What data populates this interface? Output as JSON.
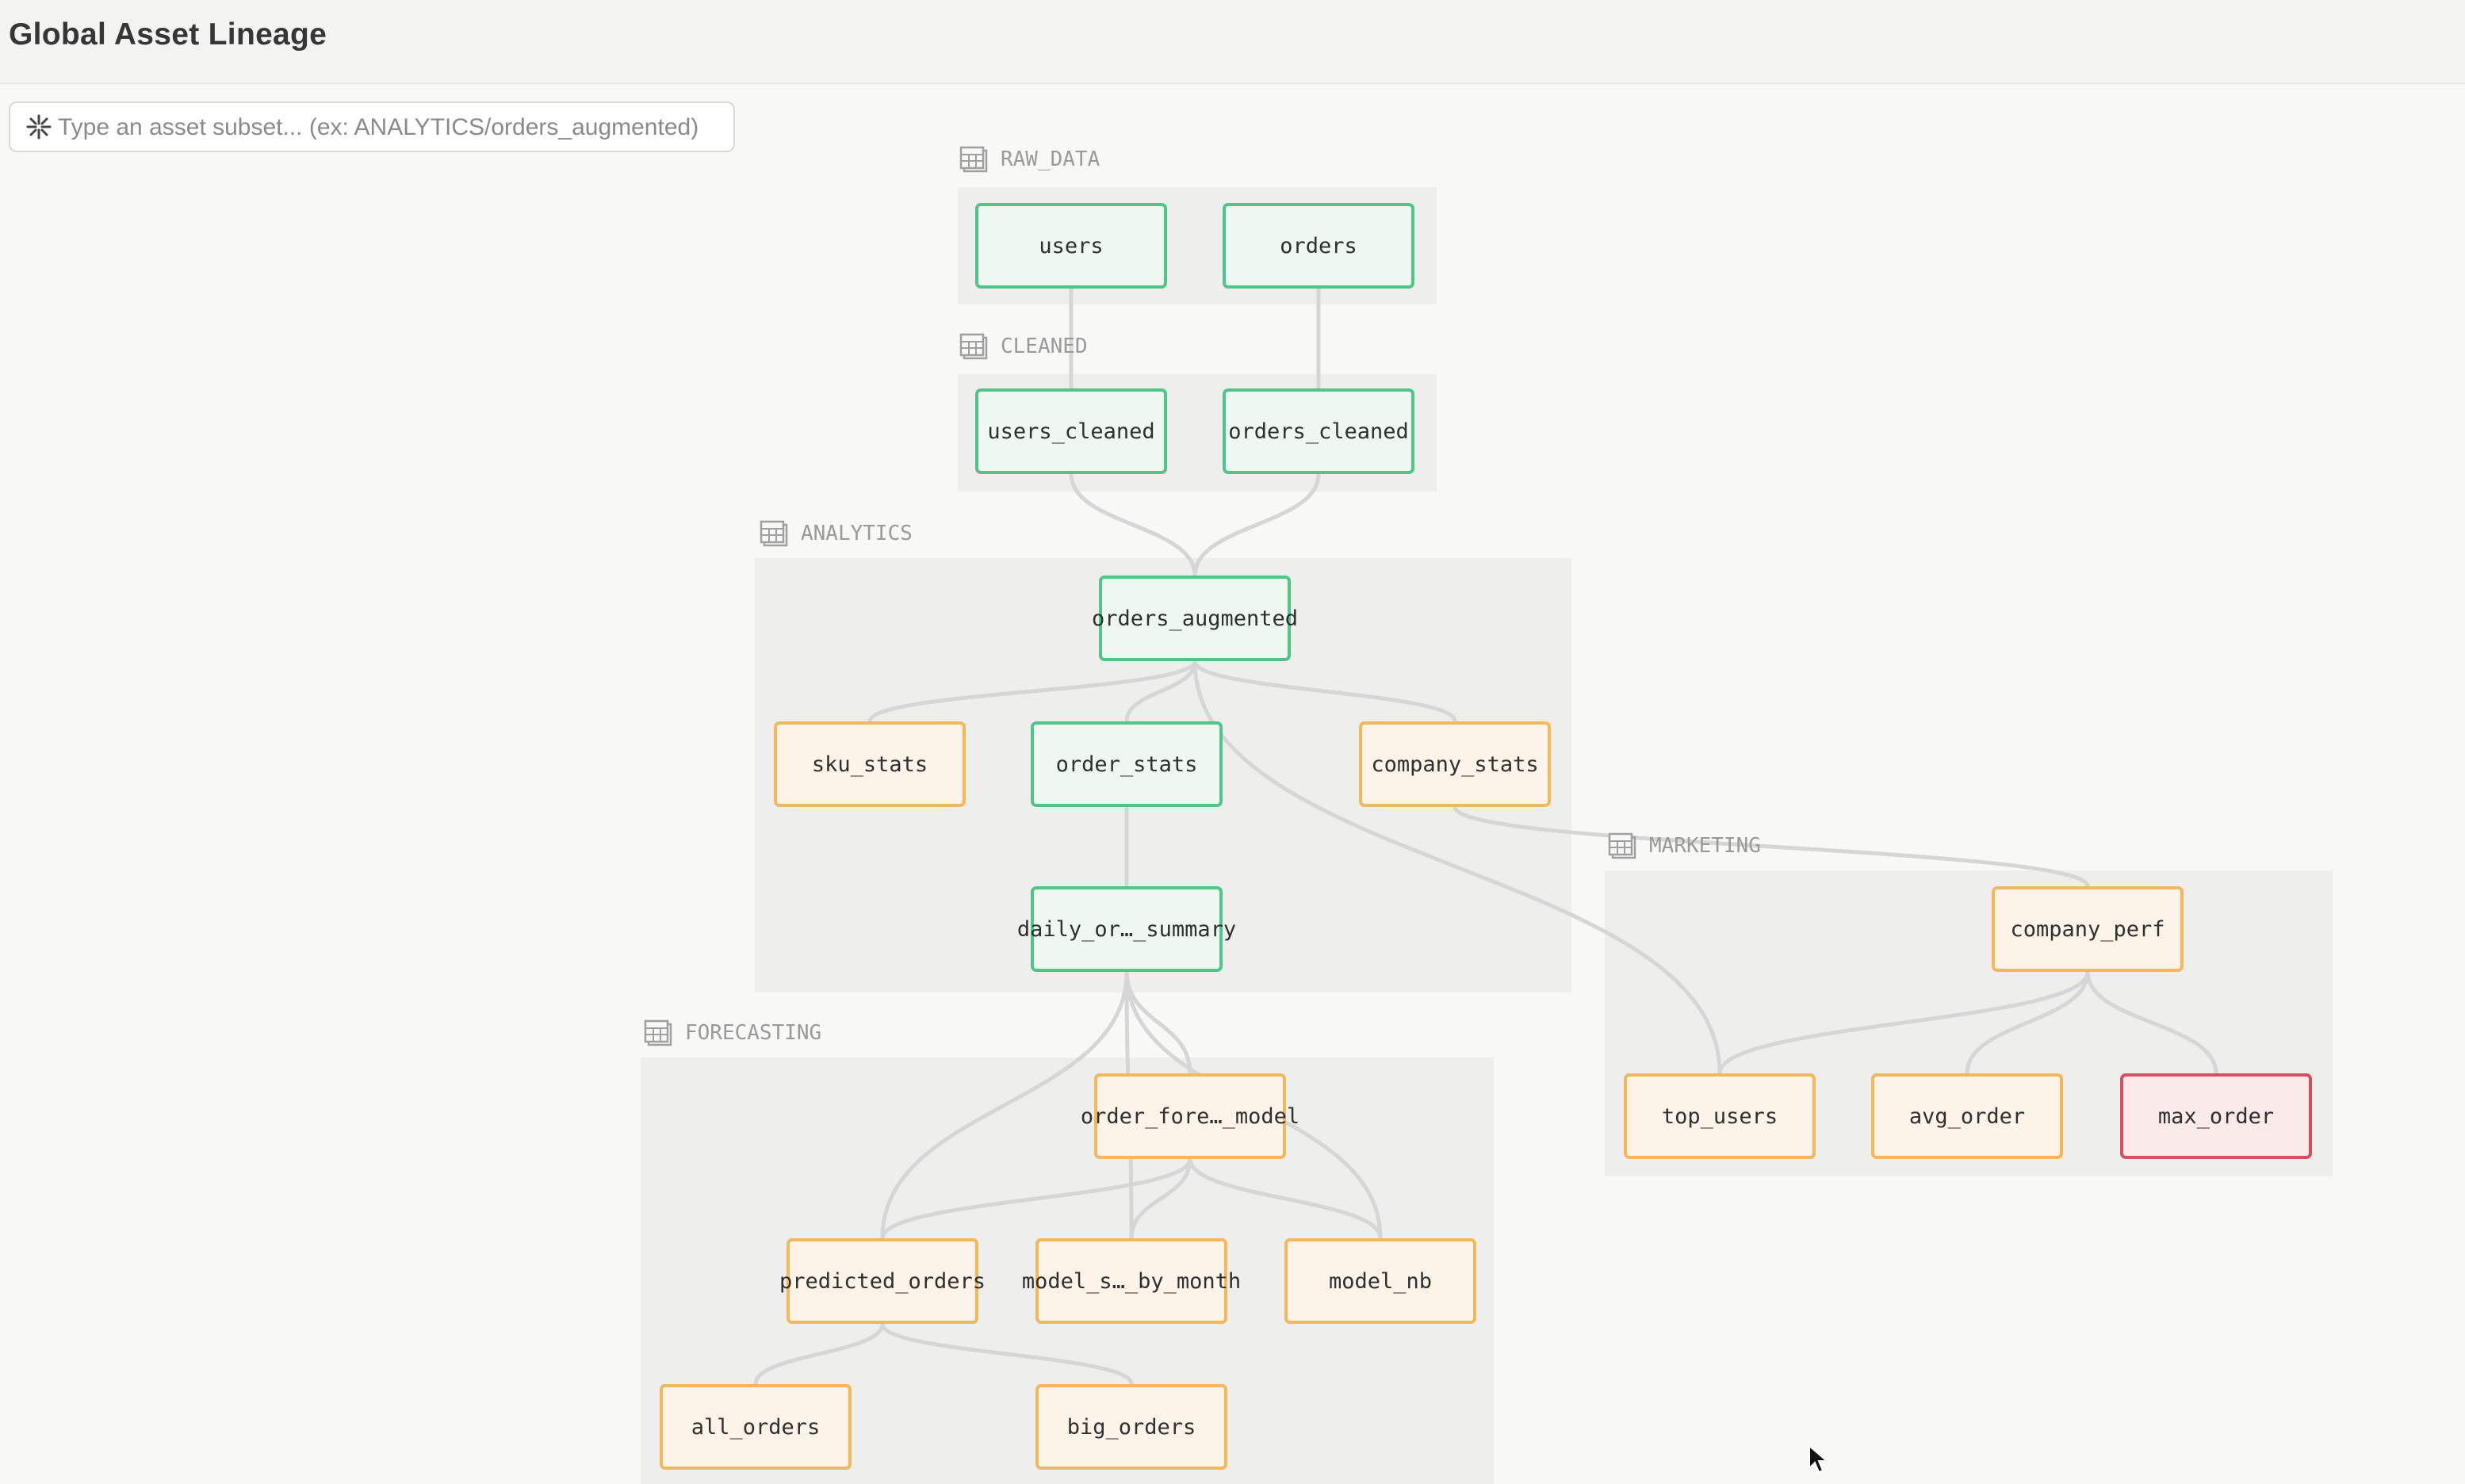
{
  "header": {
    "title": "Global Asset Lineage"
  },
  "search": {
    "placeholder": "Type an asset subset... (ex: ANALYTICS/orders_augmented)",
    "icon": "asterisk-icon"
  },
  "colors": {
    "fresh_border": "#4fc58a",
    "fresh_fill": "#eef8f1",
    "stale_border": "#f1b85e",
    "stale_fill": "#fcf3e9",
    "failed_border": "#d94d63",
    "failed_fill": "#fbeaea",
    "edge": "#d6d6d6",
    "group_fill": "#eeeeec"
  },
  "groups": {
    "raw_data": {
      "label": "RAW_DATA",
      "icon": "table-icon"
    },
    "cleaned": {
      "label": "CLEANED",
      "icon": "table-icon"
    },
    "analytics": {
      "label": "ANALYTICS",
      "icon": "table-icon"
    },
    "marketing": {
      "label": "MARKETING",
      "icon": "table-icon"
    },
    "forecasting": {
      "label": "FORECASTING",
      "icon": "table-icon"
    }
  },
  "nodes": {
    "users": {
      "label": "users",
      "status": "fresh"
    },
    "orders": {
      "label": "orders",
      "status": "fresh"
    },
    "users_cleaned": {
      "label": "users_cleaned",
      "status": "fresh"
    },
    "orders_cleaned": {
      "label": "orders_cleaned",
      "status": "fresh"
    },
    "orders_augmented": {
      "label": "orders_augmented",
      "status": "fresh"
    },
    "sku_stats": {
      "label": "sku_stats",
      "status": "stale"
    },
    "order_stats": {
      "label": "order_stats",
      "status": "fresh"
    },
    "company_stats": {
      "label": "company_stats",
      "status": "stale"
    },
    "daily_summary": {
      "label": "daily_or…_summary",
      "status": "fresh"
    },
    "company_perf": {
      "label": "company_perf",
      "status": "stale"
    },
    "top_users": {
      "label": "top_users",
      "status": "stale"
    },
    "avg_order": {
      "label": "avg_order",
      "status": "stale"
    },
    "max_order": {
      "label": "max_order",
      "status": "failed"
    },
    "order_forecast_model": {
      "label": "order_fore…_model",
      "status": "stale"
    },
    "predicted_orders": {
      "label": "predicted_orders",
      "status": "stale"
    },
    "model_stats_by_month": {
      "label": "model_s…_by_month",
      "status": "stale"
    },
    "model_nb": {
      "label": "model_nb",
      "status": "stale"
    },
    "all_orders": {
      "label": "all_orders",
      "status": "stale"
    },
    "big_orders": {
      "label": "big_orders",
      "status": "stale"
    }
  },
  "edges": [
    [
      "users",
      "users_cleaned"
    ],
    [
      "orders",
      "orders_cleaned"
    ],
    [
      "users_cleaned",
      "orders_augmented"
    ],
    [
      "orders_cleaned",
      "orders_augmented"
    ],
    [
      "orders_augmented",
      "sku_stats"
    ],
    [
      "orders_augmented",
      "order_stats"
    ],
    [
      "orders_augmented",
      "company_stats"
    ],
    [
      "orders_augmented",
      "top_users"
    ],
    [
      "order_stats",
      "daily_summary"
    ],
    [
      "company_stats",
      "company_perf"
    ],
    [
      "company_perf",
      "top_users"
    ],
    [
      "company_perf",
      "avg_order"
    ],
    [
      "company_perf",
      "max_order"
    ],
    [
      "daily_summary",
      "predicted_orders"
    ],
    [
      "daily_summary",
      "model_stats_by_month"
    ],
    [
      "daily_summary",
      "order_forecast_model"
    ],
    [
      "daily_summary",
      "model_nb"
    ],
    [
      "order_forecast_model",
      "predicted_orders"
    ],
    [
      "order_forecast_model",
      "model_stats_by_month"
    ],
    [
      "order_forecast_model",
      "model_nb"
    ],
    [
      "predicted_orders",
      "all_orders"
    ],
    [
      "predicted_orders",
      "big_orders"
    ]
  ]
}
